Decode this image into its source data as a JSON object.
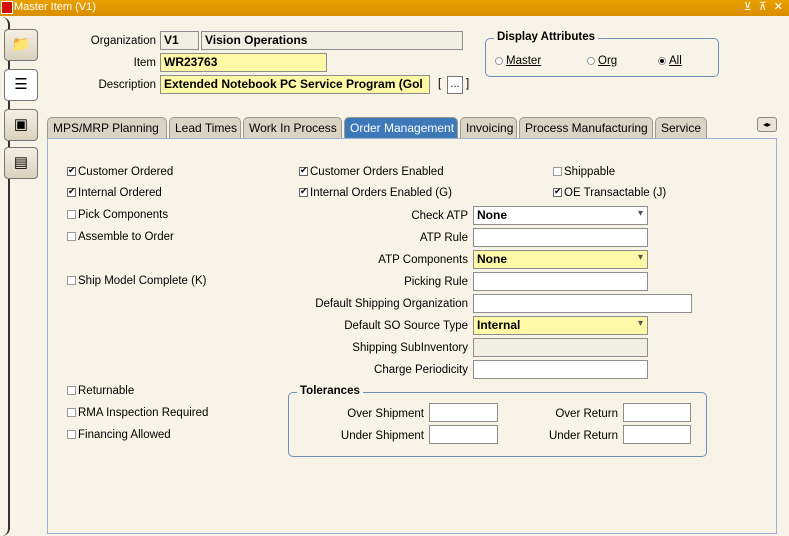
{
  "window": {
    "title": "Master Item (V1)",
    "controls": "⊻ ⊼ ✕"
  },
  "header": {
    "organization_label": "Organization",
    "organization_code": "V1",
    "organization_name": "Vision Operations",
    "item_label": "Item",
    "item_value": "WR23763",
    "description_label": "Description",
    "description_value": "Extended Notebook PC Service Program (Gol",
    "desc_button": "...",
    "bracket_left": "[",
    "bracket_right": "]"
  },
  "display_attributes": {
    "title": "Display Attributes",
    "options": [
      "Master",
      "Org",
      "All"
    ],
    "selected": "All"
  },
  "tabs": [
    {
      "label": "MPS/MRP Planning"
    },
    {
      "label": "Lead Times"
    },
    {
      "label": "Work In Process"
    },
    {
      "label": "Order Management",
      "active": true
    },
    {
      "label": "Invoicing"
    },
    {
      "label": "Process Manufacturing"
    },
    {
      "label": "Service"
    }
  ],
  "scroll_button": "◂▸",
  "checkboxes": {
    "customer_ordered": {
      "label": "Customer Ordered",
      "checked": true
    },
    "internal_ordered": {
      "label": "Internal Ordered",
      "checked": true
    },
    "pick_components": {
      "label": "Pick Components",
      "checked": false
    },
    "assemble_to_order": {
      "label": "Assemble to Order",
      "checked": false
    },
    "ship_model_complete": {
      "label": "Ship Model Complete (K)",
      "checked": false
    },
    "customer_orders_enabled": {
      "label": "Customer Orders Enabled",
      "checked": true
    },
    "internal_orders_enabled": {
      "label": "Internal Orders Enabled (G)",
      "checked": true
    },
    "shippable": {
      "label": "Shippable",
      "checked": false
    },
    "oe_transactable": {
      "label": "OE Transactable (J)",
      "checked": true
    },
    "returnable": {
      "label": "Returnable",
      "checked": false
    },
    "rma_inspection_required": {
      "label": "RMA Inspection Required",
      "checked": false
    },
    "financing_allowed": {
      "label": "Financing Allowed",
      "checked": false
    }
  },
  "fields": {
    "check_atp": {
      "label": "Check ATP",
      "value": "None"
    },
    "atp_rule": {
      "label": "ATP Rule",
      "value": ""
    },
    "atp_components": {
      "label": "ATP Components",
      "value": "None"
    },
    "picking_rule": {
      "label": "Picking Rule",
      "value": ""
    },
    "default_shipping_org": {
      "label": "Default Shipping Organization",
      "value": ""
    },
    "default_so_source_type": {
      "label": "Default SO Source Type",
      "value": "Internal"
    },
    "shipping_subinventory": {
      "label": "Shipping SubInventory",
      "value": ""
    },
    "charge_periodicity": {
      "label": "Charge Periodicity",
      "value": ""
    }
  },
  "tolerances": {
    "title": "Tolerances",
    "over_shipment": {
      "label": "Over Shipment",
      "value": ""
    },
    "under_shipment": {
      "label": "Under Shipment",
      "value": ""
    },
    "over_return": {
      "label": "Over Return",
      "value": ""
    },
    "under_return": {
      "label": "Under Return",
      "value": ""
    }
  },
  "colors": {
    "title_bar": "#e8a000",
    "active_tab": "#3d78b8",
    "required_field": "#fff8a6"
  }
}
